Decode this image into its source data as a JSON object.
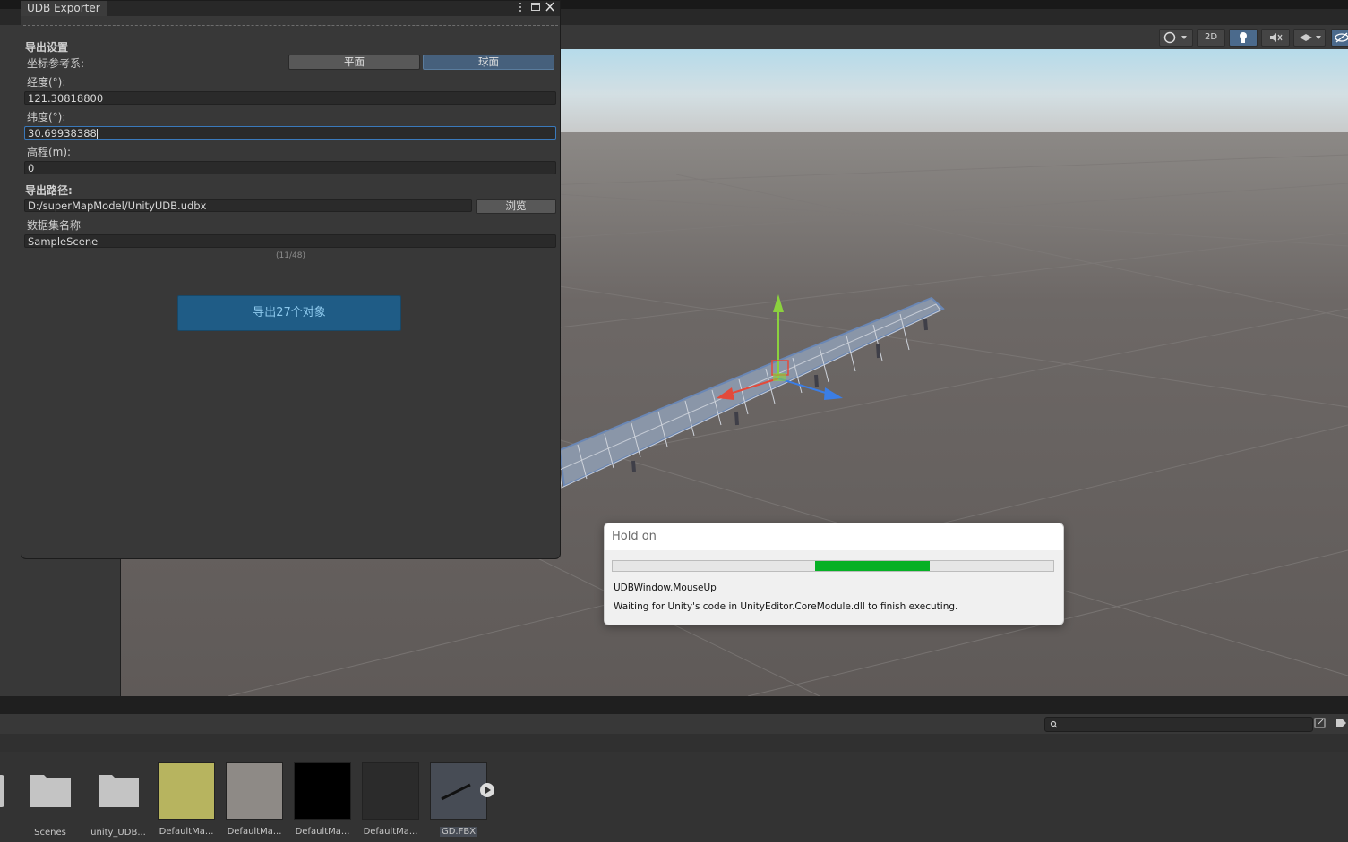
{
  "udb_window": {
    "tab_title": "UDB Exporter",
    "section_export_settings": "导出设置",
    "coord_label": "坐标参考系:",
    "coord_options": [
      "平面",
      "球面"
    ],
    "coord_selected": "球面",
    "lon_label": "经度(°):",
    "lon_value": "121.30818800",
    "lat_label": "纬度(°):",
    "lat_value": "30.69938388",
    "elev_label": "高程(m):",
    "elev_value": "0",
    "path_section": "导出路径:",
    "path_value": "D:/superMapModel/UnityUDB.udbx",
    "browse_label": "浏览",
    "dataset_label": "数据集名称",
    "dataset_value": "SampleScene",
    "counter": "(11/48)",
    "export_button": "导出27个对象"
  },
  "scene_toolbar": {
    "mode_2d": "2D"
  },
  "dialog": {
    "title": "Hold on",
    "progress": 0.26,
    "line1": "UDBWindow.MouseUp",
    "line2": "Waiting for Unity's code in UnityEditor.CoreModule.dll to finish executing."
  },
  "project": {
    "assets": [
      {
        "label": "Scenes",
        "kind": "folder"
      },
      {
        "label": "unity_UDB...",
        "kind": "folder"
      },
      {
        "label": "DefaultMa...",
        "kind": "material",
        "color": "#b7b45f"
      },
      {
        "label": "DefaultMa...",
        "kind": "material",
        "color": "#8e8a86"
      },
      {
        "label": "DefaultMa...",
        "kind": "material",
        "color": "#000000"
      },
      {
        "label": "DefaultMa...",
        "kind": "material",
        "color": "#2b2b2b"
      },
      {
        "label": "GD.FBX",
        "kind": "model",
        "color": "#474c55"
      }
    ]
  },
  "colors": {
    "accent": "#3a79bb",
    "export_button": "#1f5c86",
    "progress_fill": "#06b025"
  }
}
